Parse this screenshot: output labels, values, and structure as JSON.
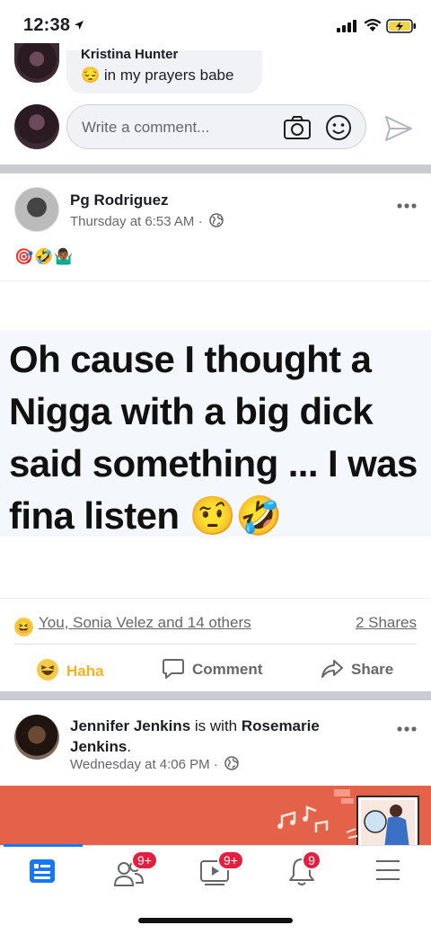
{
  "status": {
    "time": "12:38"
  },
  "prev_comment": {
    "author": "Kristina Hunter",
    "text": "😔 in my prayers babe"
  },
  "comment_box": {
    "placeholder": "Write a comment..."
  },
  "post1": {
    "author": "Pg Rodriguez",
    "time": "Thursday at 6:53 AM ·",
    "caption_emojis": "🎯🤣🤷🏾‍♂️",
    "image_text": "Oh cause I thought a Nigga with a big dick said something ... I was fina listen 🤨🤣",
    "reactions_summary": "You, Sonia Velez and 14 others",
    "shares": "2 Shares",
    "actions": {
      "haha": "Haha",
      "comment": "Comment",
      "share": "Share"
    }
  },
  "post2": {
    "author": "Jennifer Jenkins",
    "with_text": "is with",
    "tagged": "Rosemarie Jenkins",
    "period": ".",
    "time": "Wednesday at 4:06 PM ·"
  },
  "tabbar": {
    "friends_badge": "9+",
    "watch_badge": "9+",
    "notifications_badge": "9"
  },
  "colors": {
    "accent": "#1877f2",
    "haha": "#f7b125",
    "badge": "#e41e3f",
    "banner": "#e4614a"
  }
}
